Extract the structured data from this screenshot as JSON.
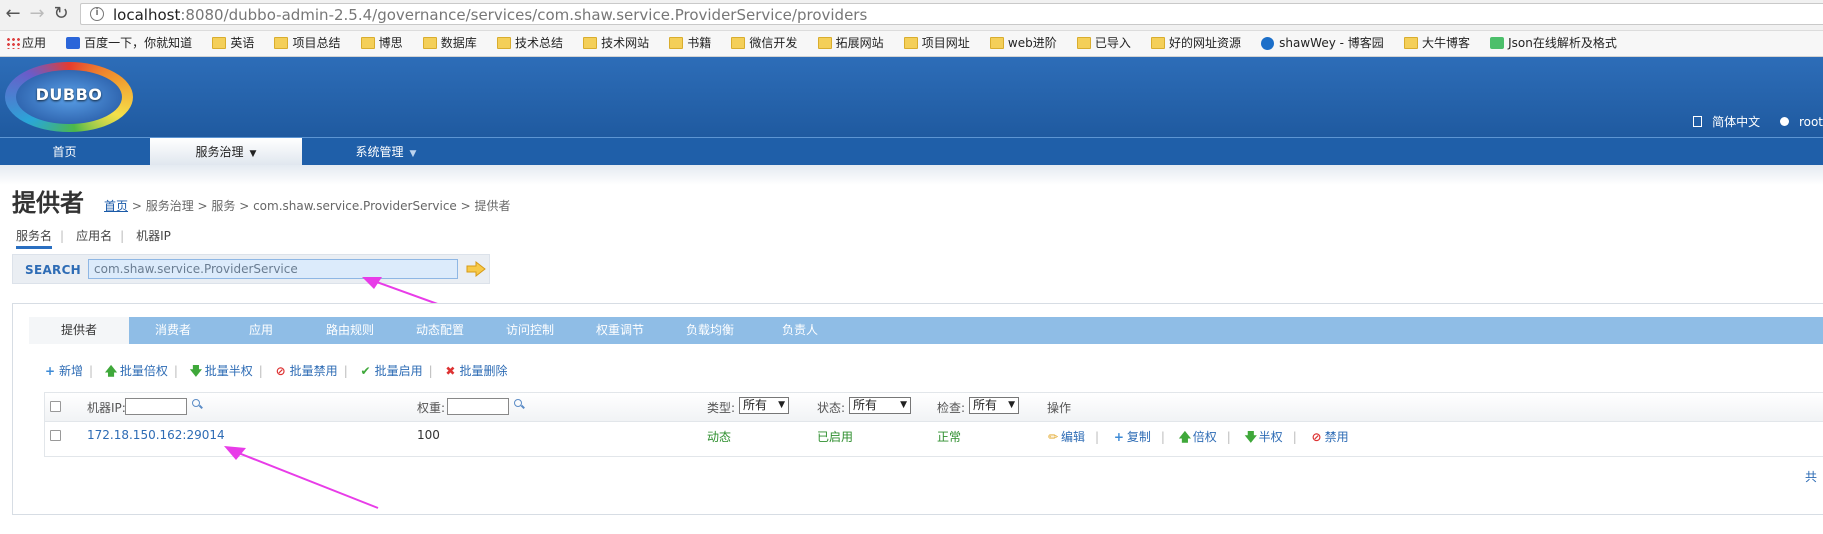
{
  "browser": {
    "back_icon": "arrow-left-icon",
    "forward_icon": "arrow-right-icon",
    "reload_icon": "reload-icon",
    "url_host": "localhost",
    "url_rest": ":8080/dubbo-admin-2.5.4/governance/services/com.shaw.service.ProviderService/providers",
    "bookmarks": [
      "应用",
      "百度一下，你就知道",
      "英语",
      "项目总结",
      "博思",
      "数据库",
      "技术总结",
      "技术网站",
      "书籍",
      "微信开发",
      "拓展网站",
      "项目网址",
      "web进阶",
      "已导入",
      "好的网址资源",
      "shawWey - 博客园",
      "大牛博客",
      "Json在线解析及格式"
    ]
  },
  "header": {
    "logo_text": "DUBBO",
    "lang": "简体中文",
    "user": "root"
  },
  "menu": {
    "home": "首页",
    "governance": "服务治理",
    "system": "系统管理"
  },
  "page": {
    "title": "提供者",
    "breadcrumb": {
      "home": "首页",
      "rest": " > 服务治理 > 服务 > com.shaw.service.ProviderService > 提供者"
    },
    "search_tabs": [
      "服务名",
      "应用名",
      "机器IP"
    ],
    "search_label": "SEARCH",
    "search_value": "com.shaw.service.ProviderService",
    "service_tabs": [
      "提供者",
      "消费者",
      "应用",
      "路由规则",
      "动态配置",
      "访问控制",
      "权重调节",
      "负载均衡",
      "负责人"
    ],
    "toolbar": [
      "新增",
      "批量倍权",
      "批量半权",
      "批量禁用",
      "批量启用",
      "批量删除"
    ],
    "columns": {
      "ip": "机器IP:",
      "weight": "权重:",
      "type": "类型:",
      "status": "状态:",
      "check": "检查:",
      "ops": "操作"
    },
    "filter_all": "所有",
    "rows": [
      {
        "address": "172.18.150.162:29014",
        "weight": "100",
        "type": "动态",
        "status": "已启用",
        "check": "正常"
      }
    ],
    "row_ops": [
      "编辑",
      "复制",
      "倍权",
      "半权",
      "禁用"
    ],
    "total": "共"
  },
  "colors": {
    "banner": "#1f5aa0",
    "tabs": "#8fbde6",
    "link": "#2e6cb5",
    "arrow": "#e83ce8"
  }
}
